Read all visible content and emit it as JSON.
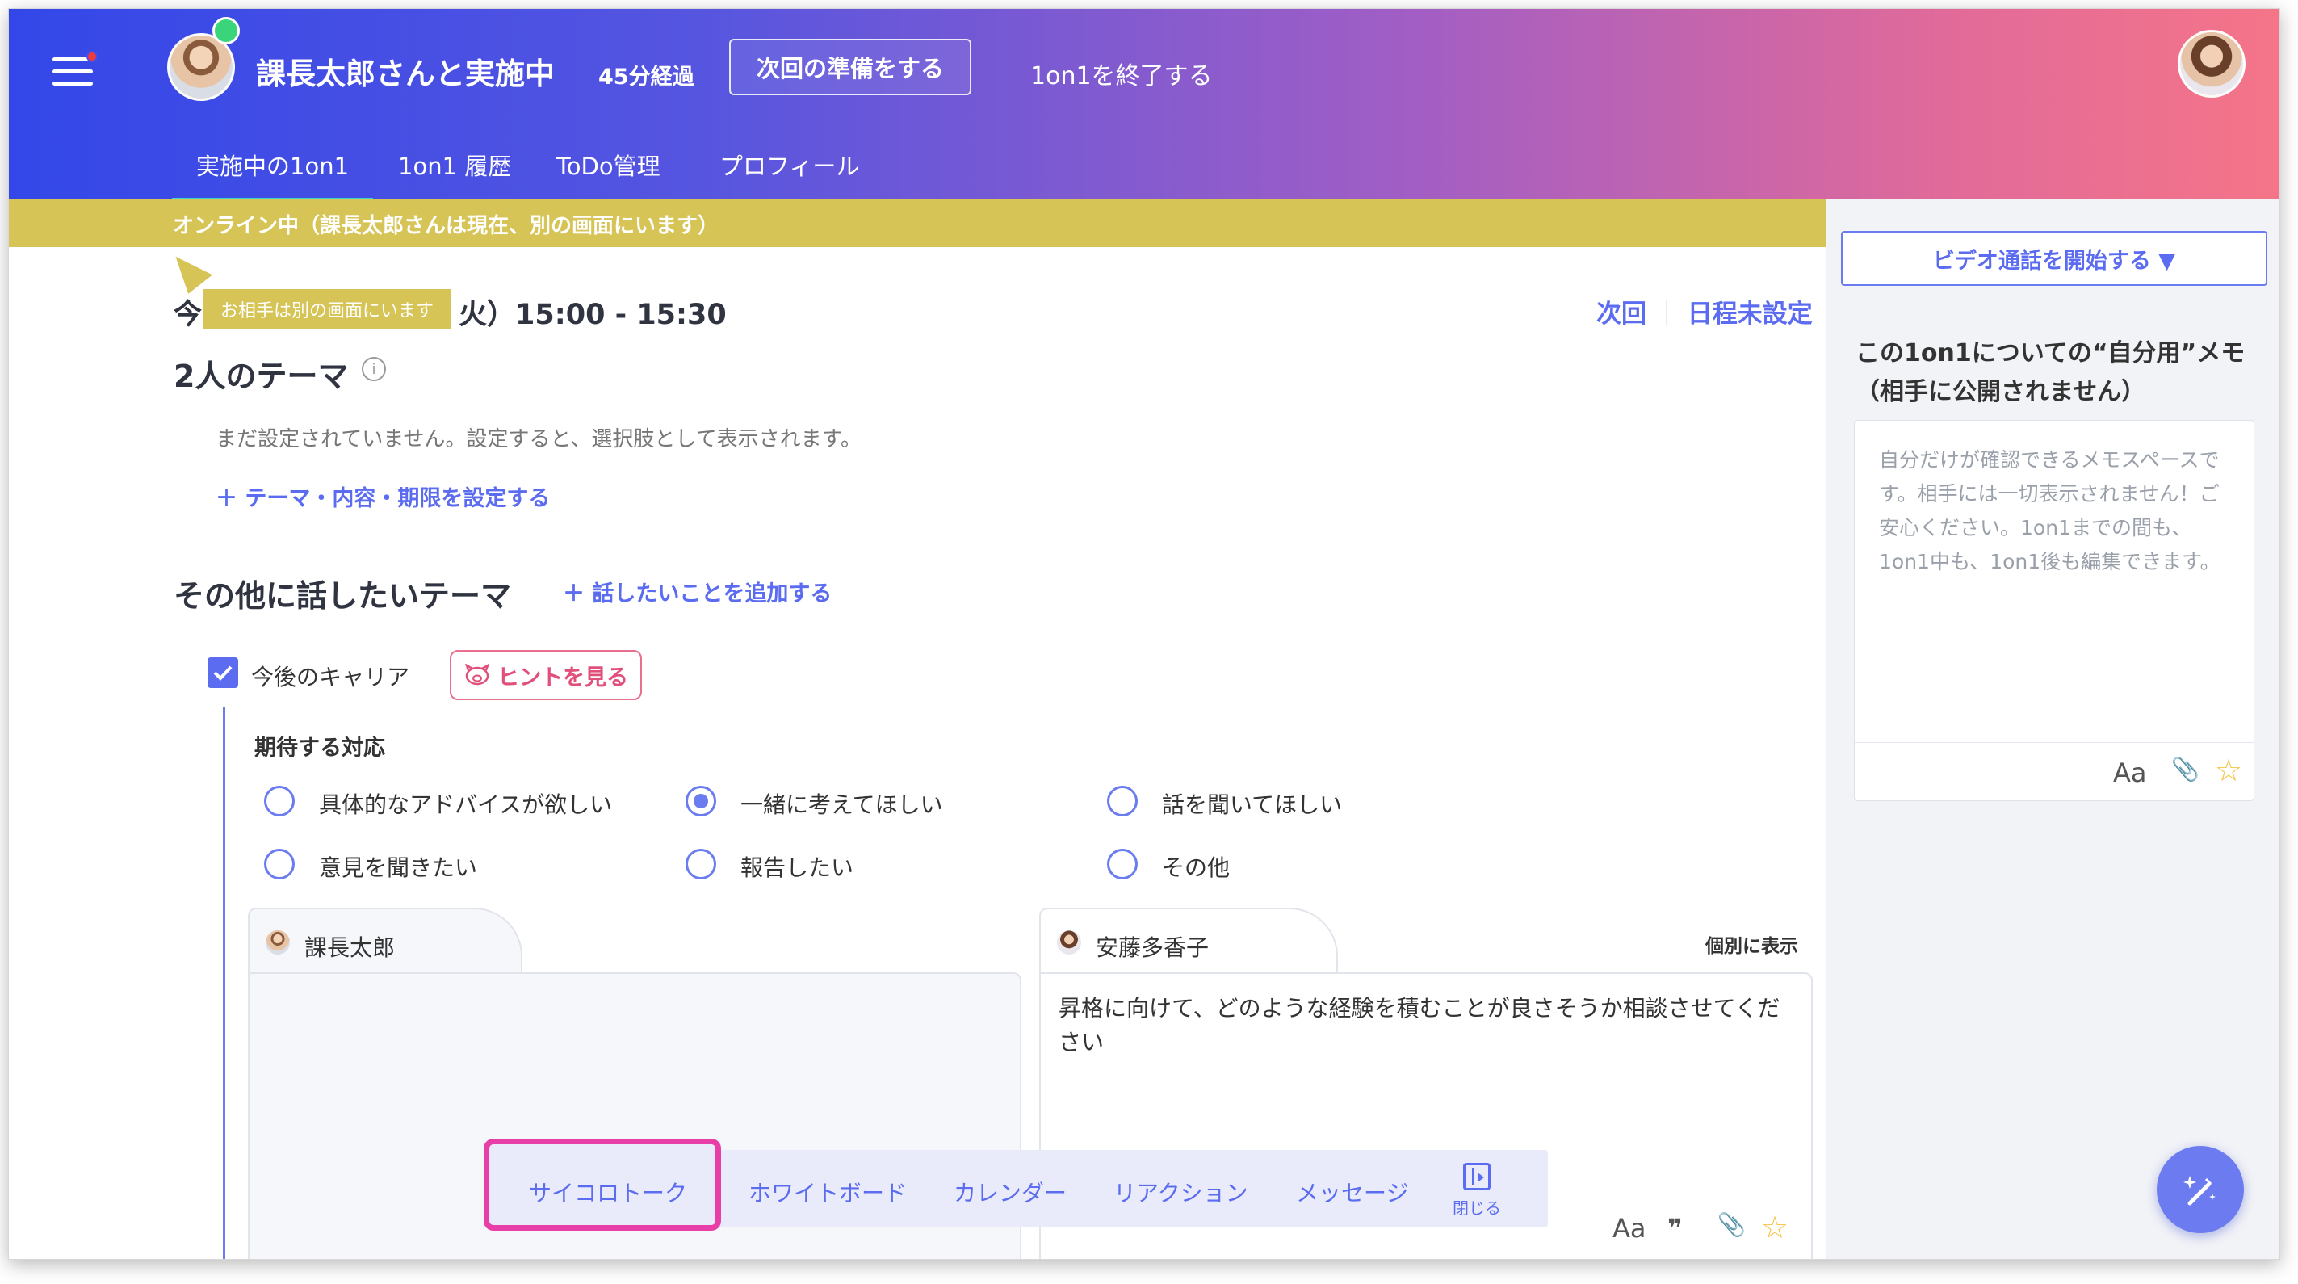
{
  "header": {
    "title": "課長太郎さんと実施中",
    "elapsed": "45分経過",
    "prepare_button": "次回の準備をする",
    "end_link": "1on1を終了する",
    "tabs": [
      {
        "label": "実施中の1on1",
        "active": true
      },
      {
        "label": "1on1 履歴",
        "active": false
      },
      {
        "label": "ToDo管理",
        "active": false
      },
      {
        "label": "プロフィール",
        "active": false
      }
    ]
  },
  "banner": {
    "text": "オンライン中（課長太郎さんは現在、別の画面にいます）"
  },
  "tooltip": {
    "text": "お相手は別の画面にいます"
  },
  "session": {
    "datetime_prefix": "今",
    "datetime_suffix": "火）15:00 - 15:30",
    "next_label": "次回",
    "next_value": "日程未設定"
  },
  "theme": {
    "heading": "2人のテーマ",
    "empty_text": "まだ設定されていません。設定すると、選択肢として表示されます。",
    "set_link": "＋ テーマ・内容・期限を設定する"
  },
  "other": {
    "heading": "その他に話したいテーマ",
    "add_link": "＋ 話したいことを追加する",
    "topic": {
      "label": "今後のキャリア",
      "checked": true,
      "hint_button": "ヒントを見る",
      "expected_heading": "期待する対応",
      "options": [
        {
          "label": "具体的なアドバイスが欲しい",
          "selected": false
        },
        {
          "label": "一緒に考えてほしい",
          "selected": true
        },
        {
          "label": "話を聞いてほしい",
          "selected": false
        },
        {
          "label": "意見を聞きたい",
          "selected": false
        },
        {
          "label": "報告したい",
          "selected": false
        },
        {
          "label": "その他",
          "selected": false
        }
      ]
    }
  },
  "cards": {
    "left": {
      "name": "課長太郎",
      "text": ""
    },
    "right": {
      "name": "安藤多香子",
      "toggle": "個別に表示",
      "text": "昇格に向けて、どのような経験を積むことが良さそうか相談させてください"
    }
  },
  "bottombar": {
    "items": [
      "サイコロトーク",
      "ホワイトボード",
      "カレンダー",
      "リアクション",
      "メッセージ"
    ],
    "selected": "サイコロトーク",
    "close": "閉じる"
  },
  "sidepanel": {
    "video_button": "ビデオ通話を開始する ▼",
    "memo_title": "この1on1についての“自分用”メモ（相手に公開されません）",
    "memo_placeholder": "自分だけが確認できるメモスペースです。相手には一切表示されません！ご安心ください。1on1までの間も、1on1中も、1on1後も編集できます。",
    "tools": {
      "text_format": "Aa",
      "quote": "❞",
      "attach": "📎",
      "star": "☆"
    }
  },
  "colors": {
    "accent": "#5b6cf0",
    "banner": "#d6c456",
    "highlight": "#e83ea8",
    "online": "#3ad57a"
  }
}
